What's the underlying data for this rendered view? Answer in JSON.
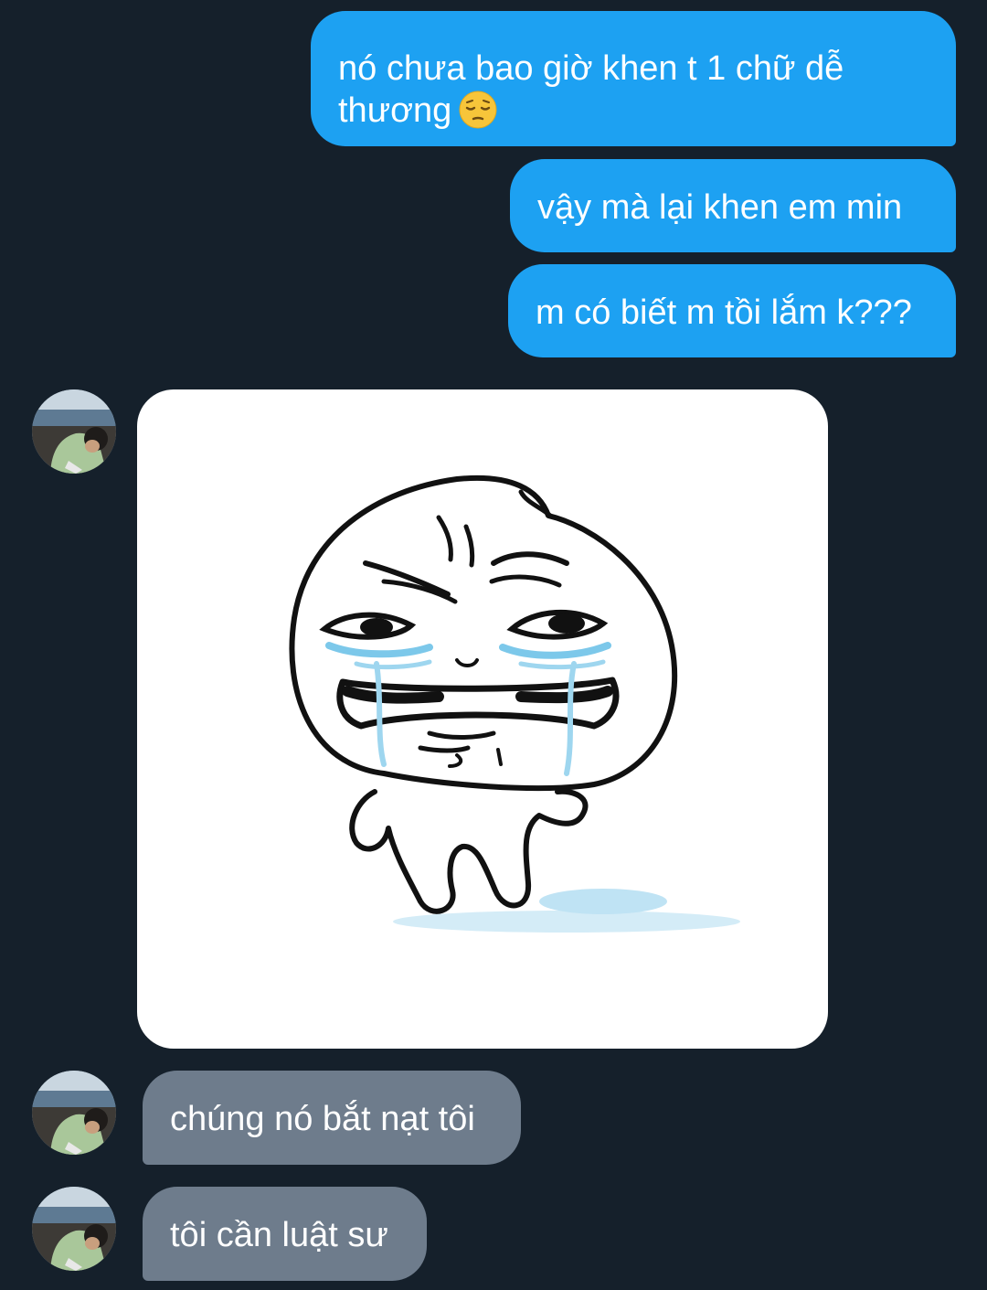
{
  "conversation": {
    "messages": [
      {
        "sender": "me",
        "text": "nó chưa bao giờ khen t 1 chữ dễ thương",
        "emoji": "pensive-face-emoji"
      },
      {
        "sender": "me",
        "text": "vậy mà lại khen em min"
      },
      {
        "sender": "me",
        "text": "m có biết m tồi lắm k???"
      },
      {
        "sender": "other",
        "type": "sticker",
        "sticker": "crying-face-sticker"
      },
      {
        "sender": "other",
        "text": "chúng nó bắt nạt tôi"
      },
      {
        "sender": "other",
        "text": "tôi cần luật sư"
      }
    ]
  },
  "colors": {
    "background": "#15202b",
    "sent_bubble": "#1da1f2",
    "received_bubble": "#6e7c8c",
    "text": "#ffffff"
  }
}
